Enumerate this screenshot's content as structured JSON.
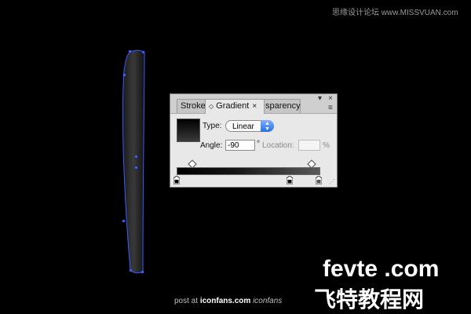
{
  "watermark_top": "思缘设计论坛 www.MISSVUAN.com",
  "panel": {
    "tabs": [
      {
        "label": "Stroke"
      },
      {
        "label": "Gradient",
        "close": "×"
      },
      {
        "label": "Transparency",
        "visible": "sparency"
      }
    ],
    "window_buttons": {
      "collapse": "▾",
      "close": "×"
    },
    "menu_icon": "≡",
    "type_label": "Type:",
    "type_value": "Linear",
    "angle_label": "Angle:",
    "angle_value": "-90",
    "angle_unit": "°",
    "location_label": "Location:",
    "location_value": "",
    "location_unit": "%"
  },
  "footer": {
    "prefix": "post at",
    "site": "iconfans.com",
    "logo": "iconfans"
  },
  "site_logo": {
    "text": "fevte .com",
    "cn": "飞特教程网"
  },
  "colors": {
    "background": "#000000",
    "selection": "#3b5bff",
    "panel": "#e8e8e8",
    "select_arrow": "#2a6fe0"
  }
}
